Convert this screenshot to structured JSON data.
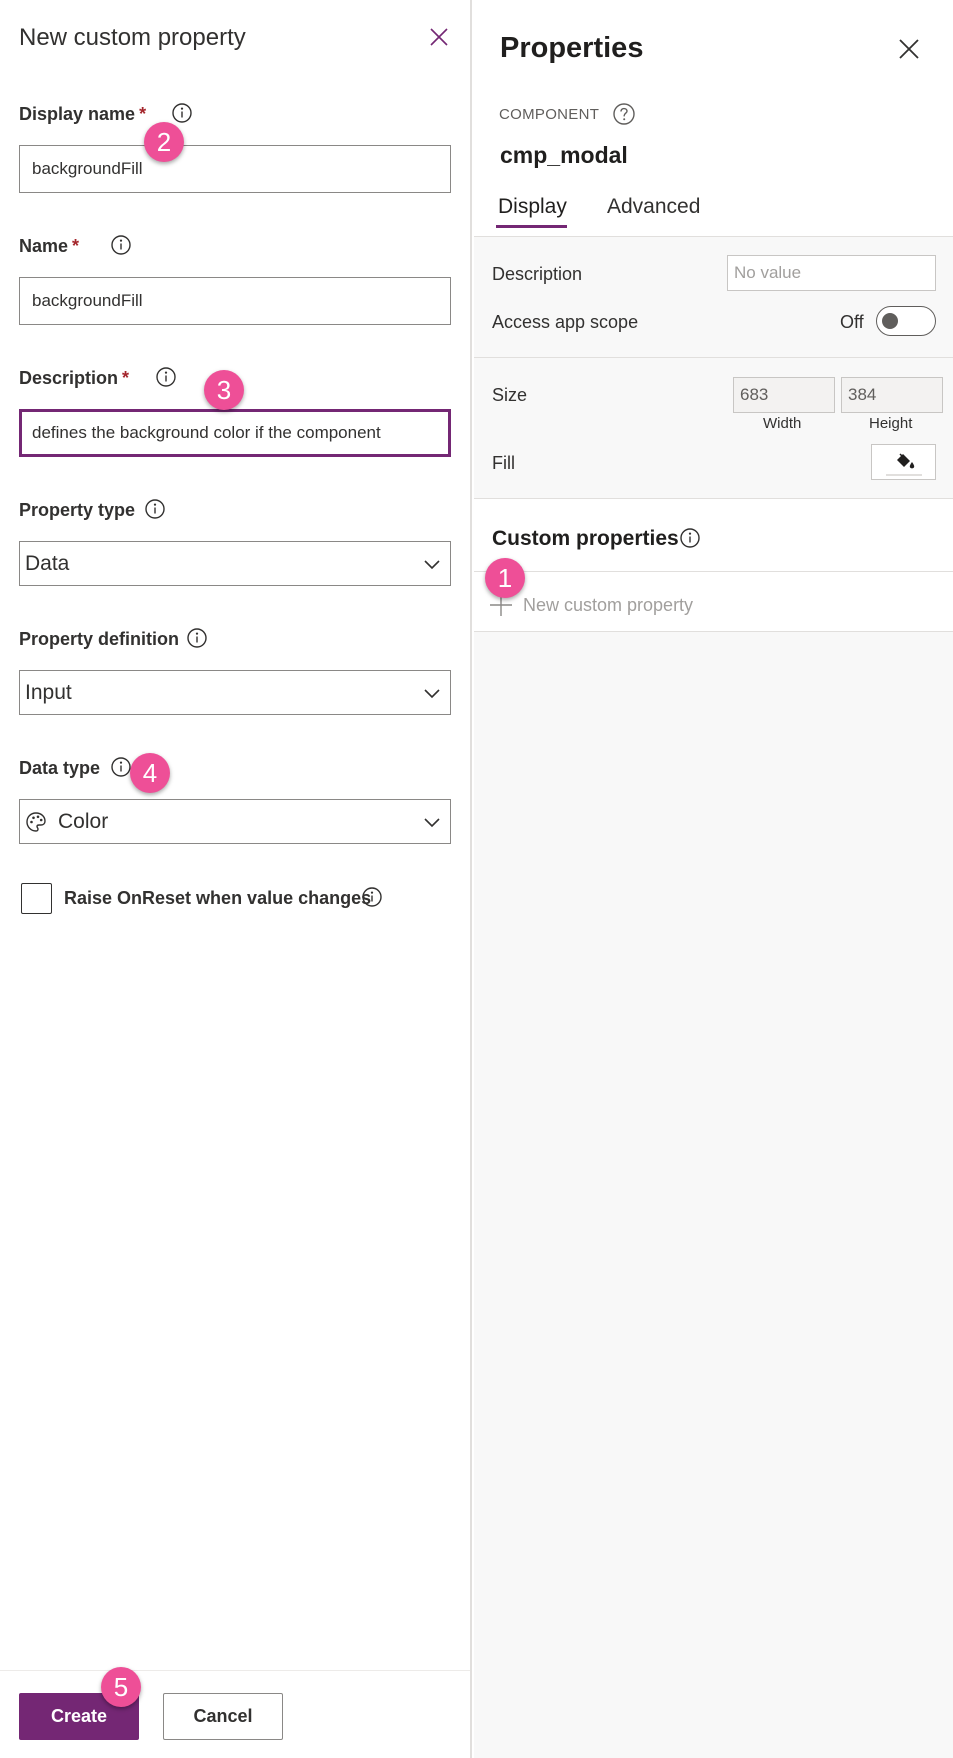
{
  "left_pane": {
    "title": "New custom property",
    "display_name": {
      "label": "Display name",
      "required_marker": "*",
      "value": "backgroundFill"
    },
    "name": {
      "label": "Name",
      "required_marker": "*",
      "value": "backgroundFill"
    },
    "description": {
      "label": "Description",
      "required_marker": "*",
      "value": "defines the background color if the component"
    },
    "property_type": {
      "label": "Property type",
      "selected": "Data"
    },
    "property_definition": {
      "label": "Property definition",
      "selected": "Input"
    },
    "data_type": {
      "label": "Data type",
      "selected": "Color",
      "icon": "palette-icon"
    },
    "raise_onreset": {
      "label": "Raise OnReset when value changes",
      "checked": false
    },
    "buttons": {
      "create": "Create",
      "cancel": "Cancel"
    }
  },
  "right_pane": {
    "title": "Properties",
    "kicker": "COMPONENT",
    "component_name": "cmp_modal",
    "tabs": [
      {
        "label": "Display",
        "active": true
      },
      {
        "label": "Advanced",
        "active": false
      }
    ],
    "description": {
      "label": "Description",
      "placeholder": "No value"
    },
    "access_app_scope": {
      "label": "Access app scope",
      "state_text": "Off",
      "on": false
    },
    "size": {
      "label": "Size",
      "width": "683",
      "height": "384",
      "width_label": "Width",
      "height_label": "Height"
    },
    "fill": {
      "label": "Fill",
      "icon": "paint-bucket-icon"
    },
    "custom_properties": {
      "title": "Custom properties",
      "new_label": "New custom property"
    }
  },
  "badges": [
    "1",
    "2",
    "3",
    "4",
    "5"
  ],
  "colors": {
    "accent": "#742774",
    "badge": "#ee4f97",
    "required": "#a4262c",
    "panel_bg": "#f8f8f8"
  }
}
